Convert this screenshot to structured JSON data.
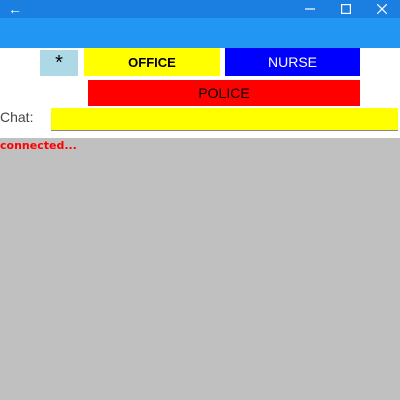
{
  "titlebar": {
    "back_icon": "←",
    "minimize_icon": "—",
    "maximize_icon": "☐",
    "close_icon": "✕",
    "bg_color": "#1a7fe0"
  },
  "appbar": {
    "bg_color": "#2196f3"
  },
  "buttons": {
    "star": "*",
    "office": "OFFICE",
    "nurse": "NURSE",
    "police": "POLICE"
  },
  "colors": {
    "star": "#add8e6",
    "office": "#ffff00",
    "nurse": "#0000ff",
    "police": "#ff0000",
    "status_text": "#ff0000",
    "content_bg": "#c0c0c0"
  },
  "chat": {
    "label": "Chat:",
    "value": "",
    "placeholder": ""
  },
  "status": {
    "text": "connected..."
  }
}
